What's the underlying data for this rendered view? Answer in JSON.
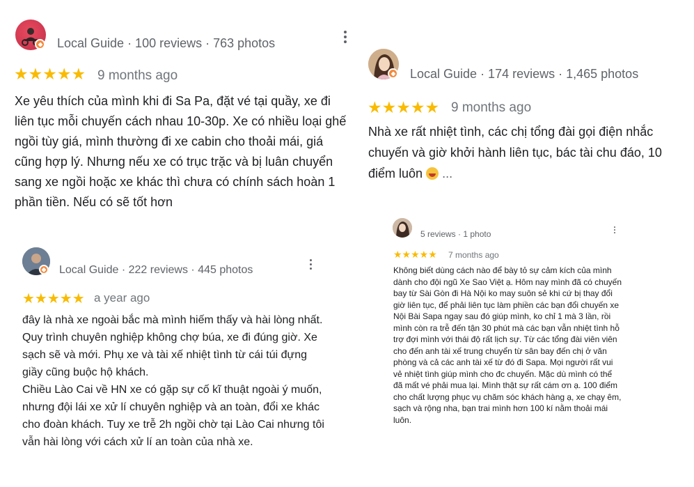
{
  "colors": {
    "star": "#f9bb02",
    "badge": "#f58a3c",
    "meta": "#5f6368",
    "text": "#202124"
  },
  "reviews": [
    {
      "meta": "Local Guide · 100 reviews · 763 photos",
      "stars": "★★★★★",
      "rating": 5,
      "ago": "9 months ago",
      "text": [
        "Xe yêu thích của mình khi đi Sa Pa, đặt vé tại quầy, xe đi liên tục mỗi chuyến cách nhau 10-30p.  Xe có nhiều loại ghế ngồi tùy giá, mình thường đi xe cabin cho thoải mái, giá cũng hợp lý. Nhưng nếu xe có trục trặc và bị luân chuyển sang xe ngồi hoặc xe khác thì chưa có chính sách hoàn 1 phần tiền. Nếu có sẽ tốt hơn"
      ]
    },
    {
      "meta": "Local Guide · 174 reviews · 1,465 photos",
      "stars": "★★★★★",
      "rating": 5,
      "ago": "9 months ago",
      "text": [
        "Nhà xe rất nhiệt tình, các chị tổng đài gọi điện nhắc chuyến và giờ khởi hành liên tục, bác tài chu đáo, 10 điểm luôn"
      ],
      "more": "...",
      "emoji": "grinning-sweat-emoji"
    },
    {
      "meta": "Local Guide · 222 reviews · 445 photos",
      "stars": "★★★★★",
      "rating": 5,
      "ago": "a year ago",
      "text": [
        "đây là nhà xe ngoài bắc mà mình hiếm thấy và hài lòng nhất. Quy trình chuyên nghiệp không chợ búa, xe đi đúng giờ. Xe sạch sẽ và mới. Phụ xe và tài xế nhiệt tình từ cái túi đựng giầy cũng buộc hộ khách.",
        "Chiều Lào Cai về HN xe có gặp sự cố kĩ thuật ngoài ý muốn, nhưng đội lái xe xử lí chuyên nghiệp và an toàn, đổi xe khác cho đoàn khách. Tuy xe trễ 2h ngồi chờ tại Lào Cai nhưng tôi vẫn hài lòng với cách xử lí an toàn của nhà xe."
      ]
    },
    {
      "meta": "5 reviews · 1 photo",
      "stars": "★★★★★",
      "rating": 5,
      "ago": "7 months ago",
      "text": [
        "Không biết dùng cách nào để bày tỏ sự cảm kích của mình dành cho đội ngũ Xe Sao Việt ạ. Hôm nay mình đã có chuyến bay từ Sài Gòn đi Hà Nội ko may suôn sẻ khi cứ bị thay đổi giờ liên tục, để phải liên tục làm phiền các bạn đổi chuyến xe Nội Bài Sapa ngay sau đó giúp mình, ko chỉ 1 mà 3 lần, rồi mình còn ra trễ đến tận 30 phút mà các bạn vẫn nhiệt tình hỗ trợ đợi mình với thái độ rất lịch sự. Từ các tổng đài viên viên cho đến anh tài xế trung chuyển từ sân bay đến chị ở văn phòng và cả các anh tài xế từ đó đi Sapa. Mọi người rất vui vẻ nhiệt tình giúp mình cho đc chuyến. Mặc dù mình có thể đã mất vé phải mua lại. Mình thật sự rất cám ơn ạ. 100 điểm cho chất lượng phục vụ chăm sóc khách hàng ạ, xe chạy êm, sạch và rộng nha, bạn trai mình hơn 100 kí nằm thoải mái luôn."
      ]
    }
  ]
}
